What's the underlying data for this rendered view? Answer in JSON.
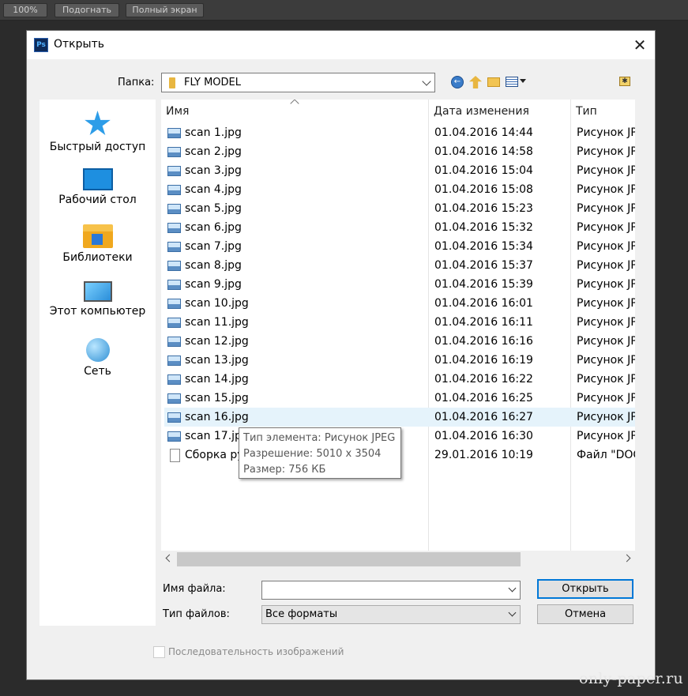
{
  "ps_toolbar": {
    "zoom_label": "100%",
    "fit_label": "Подогнать",
    "fullscreen_label": "Полный экран"
  },
  "dialog": {
    "app_icon": "ps-logo-icon",
    "app_icon_text": "Ps",
    "title": "Открыть",
    "close_glyph": "✕"
  },
  "folder": {
    "label": "Папка:",
    "current": "FLY MODEL"
  },
  "places": [
    {
      "label": "Быстрый доступ",
      "icon": "star-icon"
    },
    {
      "label": "Рабочий стол",
      "icon": "desktop-icon"
    },
    {
      "label": "Библиотеки",
      "icon": "libraries-icon"
    },
    {
      "label": "Этот компьютер",
      "icon": "computer-icon"
    },
    {
      "label": "Сеть",
      "icon": "network-icon"
    }
  ],
  "columns": {
    "name": "Имя",
    "date": "Дата изменения",
    "type": "Тип"
  },
  "files": [
    {
      "name": "scan 1.jpg",
      "date": "01.04.2016 14:44",
      "type": "Рисунок JP",
      "icon": "jpeg-icon"
    },
    {
      "name": "scan 2.jpg",
      "date": "01.04.2016 14:58",
      "type": "Рисунок JP",
      "icon": "jpeg-icon"
    },
    {
      "name": "scan 3.jpg",
      "date": "01.04.2016 15:04",
      "type": "Рисунок JP",
      "icon": "jpeg-icon"
    },
    {
      "name": "scan 4.jpg",
      "date": "01.04.2016 15:08",
      "type": "Рисунок JP",
      "icon": "jpeg-icon"
    },
    {
      "name": "scan 5.jpg",
      "date": "01.04.2016 15:23",
      "type": "Рисунок JP",
      "icon": "jpeg-icon"
    },
    {
      "name": "scan 6.jpg",
      "date": "01.04.2016 15:32",
      "type": "Рисунок JP",
      "icon": "jpeg-icon"
    },
    {
      "name": "scan 7.jpg",
      "date": "01.04.2016 15:34",
      "type": "Рисунок JP",
      "icon": "jpeg-icon"
    },
    {
      "name": "scan 8.jpg",
      "date": "01.04.2016 15:37",
      "type": "Рисунок JP",
      "icon": "jpeg-icon"
    },
    {
      "name": "scan 9.jpg",
      "date": "01.04.2016 15:39",
      "type": "Рисунок JP",
      "icon": "jpeg-icon"
    },
    {
      "name": "scan 10.jpg",
      "date": "01.04.2016 16:01",
      "type": "Рисунок JP",
      "icon": "jpeg-icon"
    },
    {
      "name": "scan 11.jpg",
      "date": "01.04.2016 16:11",
      "type": "Рисунок JP",
      "icon": "jpeg-icon"
    },
    {
      "name": "scan 12.jpg",
      "date": "01.04.2016 16:16",
      "type": "Рисунок JP",
      "icon": "jpeg-icon"
    },
    {
      "name": "scan 13.jpg",
      "date": "01.04.2016 16:19",
      "type": "Рисунок JP",
      "icon": "jpeg-icon"
    },
    {
      "name": "scan 14.jpg",
      "date": "01.04.2016 16:22",
      "type": "Рисунок JP",
      "icon": "jpeg-icon"
    },
    {
      "name": "scan 15.jpg",
      "date": "01.04.2016 16:25",
      "type": "Рисунок JP",
      "icon": "jpeg-icon"
    },
    {
      "name": "scan 16.jpg",
      "date": "01.04.2016 16:27",
      "type": "Рисунок JP",
      "icon": "jpeg-icon",
      "selected": true
    },
    {
      "name": "scan 17.jpg",
      "date": "01.04.2016 16:30",
      "type": "Рисунок JP",
      "icon": "jpeg-icon"
    },
    {
      "name": "Сборка ру",
      "date": "29.01.2016 10:19",
      "type": "Файл \"DOC",
      "icon": "document-icon"
    }
  ],
  "tooltip": {
    "type_line": "Тип элемента: Рисунок JPEG",
    "resolution_line": "Разрешение: 5010 x 3504",
    "size_line": "Размер: 756 КБ"
  },
  "filename": {
    "label": "Имя файла:",
    "value": ""
  },
  "filetype": {
    "label": "Тип файлов:",
    "value": "Все форматы"
  },
  "buttons": {
    "open": "Открыть",
    "cancel": "Отмена"
  },
  "image_sequence": {
    "label": "Последовательность изображений",
    "checked": false
  },
  "watermark": "only-paper.ru",
  "colors": {
    "selection": "#e5f3fb",
    "accent_border": "#0078d7",
    "app_background": "#2b2b2b"
  }
}
